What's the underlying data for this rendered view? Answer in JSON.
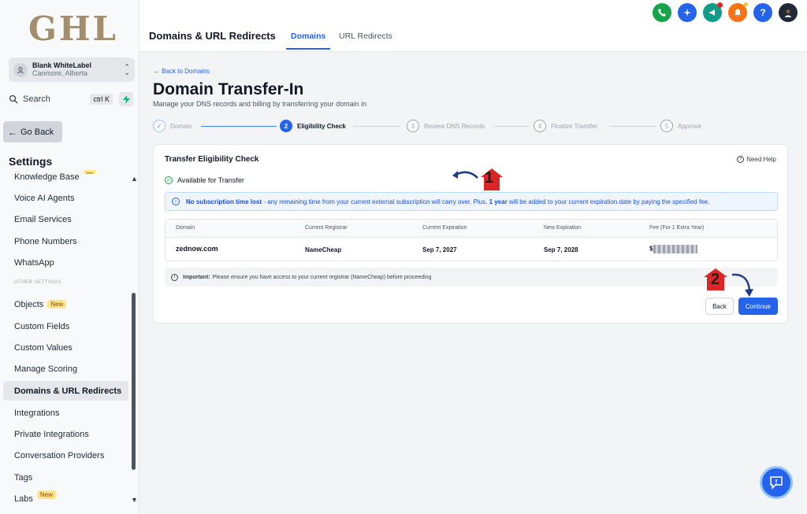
{
  "sidebar": {
    "logo": "GHL",
    "account": {
      "name": "Blank WhiteLabel",
      "location": "Canmore, Alberta"
    },
    "search": {
      "label": "Search",
      "shortcut": "ctrl K"
    },
    "go_back": "Go Back",
    "settings_title": "Settings",
    "section_other": "OTHER SETTINGS",
    "badge_new": "New",
    "items": [
      {
        "label": "Knowledge Base"
      },
      {
        "label": "Voice AI Agents"
      },
      {
        "label": "Email Services"
      },
      {
        "label": "Phone Numbers"
      },
      {
        "label": "WhatsApp"
      },
      {
        "label": "Objects"
      },
      {
        "label": "Custom Fields"
      },
      {
        "label": "Custom Values"
      },
      {
        "label": "Manage Scoring"
      },
      {
        "label": "Domains & URL Redirects"
      },
      {
        "label": "Integrations"
      },
      {
        "label": "Private Integrations"
      },
      {
        "label": "Conversation Providers"
      },
      {
        "label": "Tags"
      },
      {
        "label": "Labs"
      }
    ]
  },
  "header": {
    "title": "Domains & URL Redirects",
    "tabs": [
      {
        "label": "Domains"
      },
      {
        "label": "URL Redirects"
      }
    ],
    "icons": [
      "phone-icon",
      "sparkle-icon",
      "megaphone-icon",
      "bell-icon",
      "help-icon",
      "user-avatar"
    ],
    "help_glyph": "?"
  },
  "main": {
    "back_link": "Back to Domains",
    "title": "Domain Transfer-In",
    "subtitle": "Manage your DNS records and billing by transferring your domain in",
    "steps": [
      {
        "num": "✓",
        "label": "Domain"
      },
      {
        "num": "2",
        "label": "Eligibility Check"
      },
      {
        "num": "3",
        "label": "Review DNS Records"
      },
      {
        "num": "4",
        "label": "Finalize Transfer"
      },
      {
        "num": "5",
        "label": "Approve"
      }
    ],
    "card": {
      "title": "Transfer Eligibility Check",
      "need_help": "Need Help",
      "available": "Available for Transfer",
      "info_bold": "No subscription time lost",
      "info_text_1": " - any remaining time from your current external subscription will carry over. Plus, ",
      "info_bold_2": "1 year",
      "info_text_2": " will be added to your current expiration date by paying the specified fee.",
      "table": {
        "headers": [
          "Domain",
          "Current Registrar",
          "Current Expiration",
          "New Expiration",
          "Fee (For 1 Extra Year)"
        ],
        "row": {
          "domain": "zednow.com",
          "registrar": "NameCheap",
          "current_exp": "Sep 7, 2027",
          "new_exp": "Sep 7, 2028",
          "fee_prefix": "$"
        }
      },
      "important_label": "Important:",
      "important_text": "Please ensure you have access to your current registrar (NameCheap) before proceeding",
      "back_button": "Back",
      "continue_button": "Continue"
    },
    "annotations": {
      "one": "1",
      "two": "2"
    }
  },
  "colors": {
    "primary": "#2563eb",
    "annotation_red": "#dc2626",
    "annotation_arrow": "#1e3a8a",
    "logo_gold": "#a38d6b"
  }
}
